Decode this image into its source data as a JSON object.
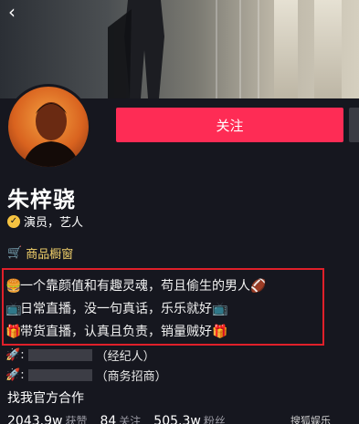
{
  "header": {
    "back_icon": "back-arrow-icon"
  },
  "profile": {
    "follow_label": "关注",
    "name": "朱梓骁",
    "verification": "演员，艺人",
    "shop_label": "商品橱窗"
  },
  "bio": {
    "lines": [
      {
        "emoji_left": "🍔",
        "text": "一个靠颜值和有趣灵魂，苟且偷生的男人",
        "emoji_right": "🏈"
      },
      {
        "emoji_left": "📺",
        "text": "日常直播，没一句真话，乐乐就好",
        "emoji_right": "📺"
      },
      {
        "emoji_left": "🎁",
        "text": "带货直播，认真且负责，销量贼好",
        "emoji_right": "🎁"
      }
    ]
  },
  "contacts": [
    {
      "icon": "rocket-icon",
      "suffix": "（经纪人）"
    },
    {
      "icon": "rocket-icon",
      "suffix": "（商务招商）"
    }
  ],
  "official_link": "找我官方合作",
  "stats": [
    {
      "value": "2043.9w",
      "label": "获赞"
    },
    {
      "value": "84",
      "label": "关注"
    },
    {
      "value": "505.3w",
      "label": "粉丝"
    }
  ],
  "watermark": "搜狐娱乐",
  "colors": {
    "accent": "#fe2c55",
    "background": "#16171f",
    "highlight_border": "#e0202a",
    "shop": "#f2d16b"
  }
}
